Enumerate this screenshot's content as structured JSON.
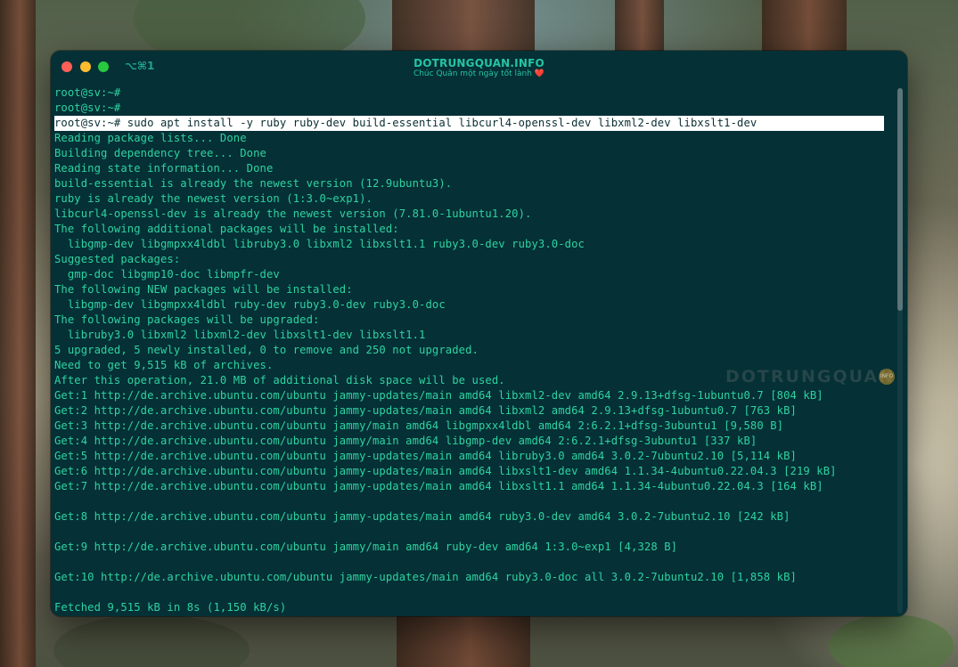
{
  "window": {
    "shortcut": "⌥⌘1",
    "title": "DOTRUNGQUAN.INFO",
    "subtitle": "Chúc Quân một ngày tốt lành",
    "subtitle_heart": "❤️"
  },
  "watermark": {
    "text": "DOTRUNGQUAN",
    "badge": "INFO"
  },
  "terminal": {
    "lines": [
      "root@sv:~#",
      "root@sv:~#",
      "root@sv:~# sudo apt install -y ruby ruby-dev build-essential libcurl4-openssl-dev libxml2-dev libxslt1-dev",
      "Reading package lists... Done",
      "Building dependency tree... Done",
      "Reading state information... Done",
      "build-essential is already the newest version (12.9ubuntu3).",
      "ruby is already the newest version (1:3.0~exp1).",
      "libcurl4-openssl-dev is already the newest version (7.81.0-1ubuntu1.20).",
      "The following additional packages will be installed:",
      "  libgmp-dev libgmpxx4ldbl libruby3.0 libxml2 libxslt1.1 ruby3.0-dev ruby3.0-doc",
      "Suggested packages:",
      "  gmp-doc libgmp10-doc libmpfr-dev",
      "The following NEW packages will be installed:",
      "  libgmp-dev libgmpxx4ldbl ruby-dev ruby3.0-dev ruby3.0-doc",
      "The following packages will be upgraded:",
      "  libruby3.0 libxml2 libxml2-dev libxslt1-dev libxslt1.1",
      "5 upgraded, 5 newly installed, 0 to remove and 250 not upgraded.",
      "Need to get 9,515 kB of archives.",
      "After this operation, 21.0 MB of additional disk space will be used.",
      "Get:1 http://de.archive.ubuntu.com/ubuntu jammy-updates/main amd64 libxml2-dev amd64 2.9.13+dfsg-1ubuntu0.7 [804 kB]",
      "Get:2 http://de.archive.ubuntu.com/ubuntu jammy-updates/main amd64 libxml2 amd64 2.9.13+dfsg-1ubuntu0.7 [763 kB]",
      "Get:3 http://de.archive.ubuntu.com/ubuntu jammy/main amd64 libgmpxx4ldbl amd64 2:6.2.1+dfsg-3ubuntu1 [9,580 B]",
      "Get:4 http://de.archive.ubuntu.com/ubuntu jammy/main amd64 libgmp-dev amd64 2:6.2.1+dfsg-3ubuntu1 [337 kB]",
      "Get:5 http://de.archive.ubuntu.com/ubuntu jammy-updates/main amd64 libruby3.0 amd64 3.0.2-7ubuntu2.10 [5,114 kB]",
      "Get:6 http://de.archive.ubuntu.com/ubuntu jammy-updates/main amd64 libxslt1-dev amd64 1.1.34-4ubuntu0.22.04.3 [219 kB]",
      "Get:7 http://de.archive.ubuntu.com/ubuntu jammy-updates/main amd64 libxslt1.1 amd64 1.1.34-4ubuntu0.22.04.3 [164 kB]",
      "",
      "Get:8 http://de.archive.ubuntu.com/ubuntu jammy-updates/main amd64 ruby3.0-dev amd64 3.0.2-7ubuntu2.10 [242 kB]",
      "",
      "Get:9 http://de.archive.ubuntu.com/ubuntu jammy/main amd64 ruby-dev amd64 1:3.0~exp1 [4,328 B]",
      "",
      "Get:10 http://de.archive.ubuntu.com/ubuntu jammy-updates/main amd64 ruby3.0-doc all 3.0.2-7ubuntu2.10 [1,858 kB]",
      "",
      "Fetched 9,515 kB in 8s (1,150 kB/s)"
    ]
  }
}
